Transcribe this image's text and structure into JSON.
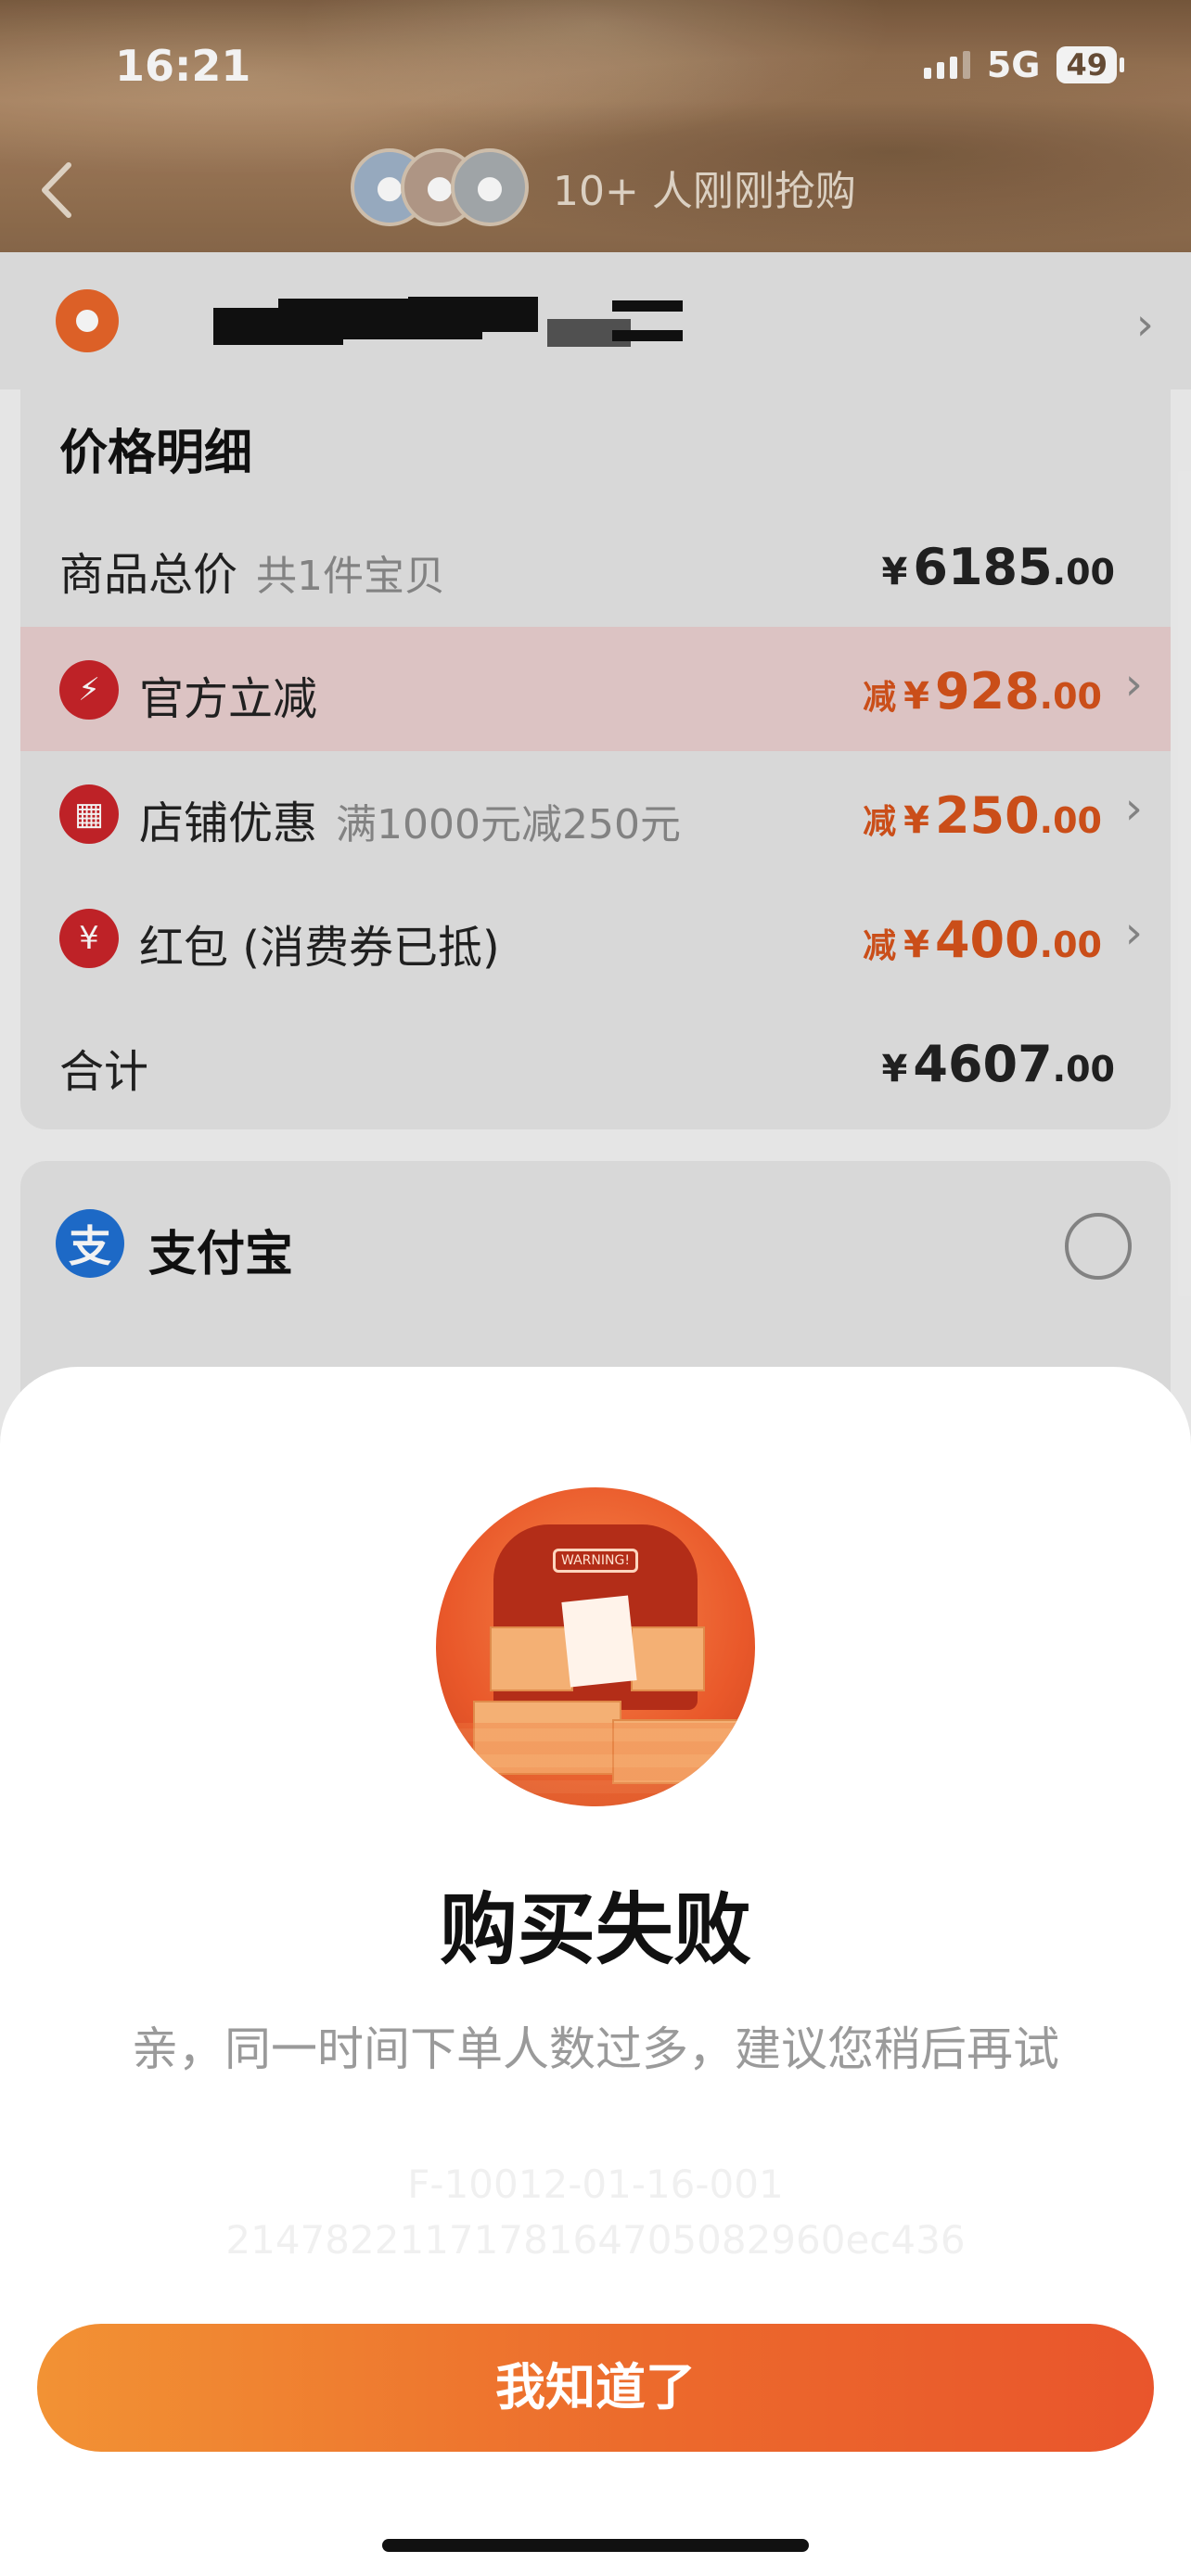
{
  "status": {
    "time": "16:21",
    "network": "5G",
    "battery": "49"
  },
  "header": {
    "buyers_text": "10+ 人刚刚抢购"
  },
  "price_detail": {
    "title": "价格明细",
    "rows": [
      {
        "label": "商品总价",
        "sub": "共1件宝贝",
        "prefix": "",
        "yen": "¥",
        "int": "6185",
        "dec": ".00"
      },
      {
        "label": "官方立减",
        "sub": "",
        "prefix": "减",
        "yen": "¥",
        "int": "928",
        "dec": ".00"
      },
      {
        "label": "店铺优惠",
        "sub": "满1000元减250元",
        "prefix": "减",
        "yen": "¥",
        "int": "250",
        "dec": ".00"
      },
      {
        "label": "红包 (消费券已抵)",
        "sub": "",
        "prefix": "减",
        "yen": "¥",
        "int": "400",
        "dec": ".00"
      },
      {
        "label": "合计",
        "sub": "",
        "prefix": "",
        "yen": "¥",
        "int": "4607",
        "dec": ".00"
      }
    ]
  },
  "payment": {
    "method": "支付宝",
    "icon_glyph": "支"
  },
  "dialog": {
    "title": "购买失败",
    "message": "亲，同一时间下单人数过多，建议您稍后再试",
    "code_line1": "F-10012-01-16-001",
    "code_line2": "2147822117178164705082960ec436",
    "illustration_label": "WARNING!",
    "button": "我知道了"
  },
  "colors": {
    "accent": "#ec6a2c",
    "discount_red": "#d5531b",
    "alipay_blue": "#1f6fd1"
  }
}
